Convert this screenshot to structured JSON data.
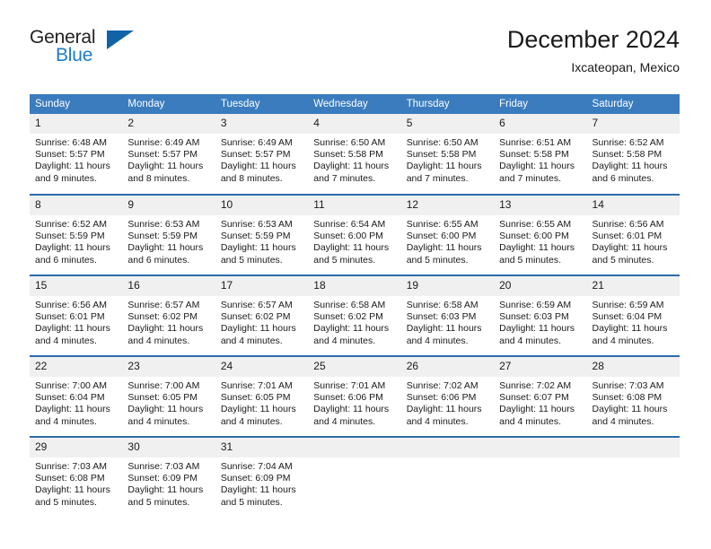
{
  "logo": {
    "word_top": "General",
    "word_bottom": "Blue",
    "triangle_color": "#1163a8",
    "blue_color": "#1d7dc4"
  },
  "header": {
    "title": "December 2024",
    "subtitle": "Ixcateopan, Mexico"
  },
  "colors": {
    "header_row_bg": "#3a7cbe",
    "header_row_text": "#ffffff",
    "row_separator": "#2b6ca8",
    "daynum_bg": "#f0f0f0",
    "page_bg": "#ffffff",
    "text": "#1a1a1a"
  },
  "calendar": {
    "weekday_headers": [
      "Sunday",
      "Monday",
      "Tuesday",
      "Wednesday",
      "Thursday",
      "Friday",
      "Saturday"
    ],
    "weeks": [
      [
        {
          "day": "1",
          "sunrise": "Sunrise: 6:48 AM",
          "sunset": "Sunset: 5:57 PM",
          "daylight_line1": "Daylight: 11 hours",
          "daylight_line2": "and 9 minutes."
        },
        {
          "day": "2",
          "sunrise": "Sunrise: 6:49 AM",
          "sunset": "Sunset: 5:57 PM",
          "daylight_line1": "Daylight: 11 hours",
          "daylight_line2": "and 8 minutes."
        },
        {
          "day": "3",
          "sunrise": "Sunrise: 6:49 AM",
          "sunset": "Sunset: 5:57 PM",
          "daylight_line1": "Daylight: 11 hours",
          "daylight_line2": "and 8 minutes."
        },
        {
          "day": "4",
          "sunrise": "Sunrise: 6:50 AM",
          "sunset": "Sunset: 5:58 PM",
          "daylight_line1": "Daylight: 11 hours",
          "daylight_line2": "and 7 minutes."
        },
        {
          "day": "5",
          "sunrise": "Sunrise: 6:50 AM",
          "sunset": "Sunset: 5:58 PM",
          "daylight_line1": "Daylight: 11 hours",
          "daylight_line2": "and 7 minutes."
        },
        {
          "day": "6",
          "sunrise": "Sunrise: 6:51 AM",
          "sunset": "Sunset: 5:58 PM",
          "daylight_line1": "Daylight: 11 hours",
          "daylight_line2": "and 7 minutes."
        },
        {
          "day": "7",
          "sunrise": "Sunrise: 6:52 AM",
          "sunset": "Sunset: 5:58 PM",
          "daylight_line1": "Daylight: 11 hours",
          "daylight_line2": "and 6 minutes."
        }
      ],
      [
        {
          "day": "8",
          "sunrise": "Sunrise: 6:52 AM",
          "sunset": "Sunset: 5:59 PM",
          "daylight_line1": "Daylight: 11 hours",
          "daylight_line2": "and 6 minutes."
        },
        {
          "day": "9",
          "sunrise": "Sunrise: 6:53 AM",
          "sunset": "Sunset: 5:59 PM",
          "daylight_line1": "Daylight: 11 hours",
          "daylight_line2": "and 6 minutes."
        },
        {
          "day": "10",
          "sunrise": "Sunrise: 6:53 AM",
          "sunset": "Sunset: 5:59 PM",
          "daylight_line1": "Daylight: 11 hours",
          "daylight_line2": "and 5 minutes."
        },
        {
          "day": "11",
          "sunrise": "Sunrise: 6:54 AM",
          "sunset": "Sunset: 6:00 PM",
          "daylight_line1": "Daylight: 11 hours",
          "daylight_line2": "and 5 minutes."
        },
        {
          "day": "12",
          "sunrise": "Sunrise: 6:55 AM",
          "sunset": "Sunset: 6:00 PM",
          "daylight_line1": "Daylight: 11 hours",
          "daylight_line2": "and 5 minutes."
        },
        {
          "day": "13",
          "sunrise": "Sunrise: 6:55 AM",
          "sunset": "Sunset: 6:00 PM",
          "daylight_line1": "Daylight: 11 hours",
          "daylight_line2": "and 5 minutes."
        },
        {
          "day": "14",
          "sunrise": "Sunrise: 6:56 AM",
          "sunset": "Sunset: 6:01 PM",
          "daylight_line1": "Daylight: 11 hours",
          "daylight_line2": "and 5 minutes."
        }
      ],
      [
        {
          "day": "15",
          "sunrise": "Sunrise: 6:56 AM",
          "sunset": "Sunset: 6:01 PM",
          "daylight_line1": "Daylight: 11 hours",
          "daylight_line2": "and 4 minutes."
        },
        {
          "day": "16",
          "sunrise": "Sunrise: 6:57 AM",
          "sunset": "Sunset: 6:02 PM",
          "daylight_line1": "Daylight: 11 hours",
          "daylight_line2": "and 4 minutes."
        },
        {
          "day": "17",
          "sunrise": "Sunrise: 6:57 AM",
          "sunset": "Sunset: 6:02 PM",
          "daylight_line1": "Daylight: 11 hours",
          "daylight_line2": "and 4 minutes."
        },
        {
          "day": "18",
          "sunrise": "Sunrise: 6:58 AM",
          "sunset": "Sunset: 6:02 PM",
          "daylight_line1": "Daylight: 11 hours",
          "daylight_line2": "and 4 minutes."
        },
        {
          "day": "19",
          "sunrise": "Sunrise: 6:58 AM",
          "sunset": "Sunset: 6:03 PM",
          "daylight_line1": "Daylight: 11 hours",
          "daylight_line2": "and 4 minutes."
        },
        {
          "day": "20",
          "sunrise": "Sunrise: 6:59 AM",
          "sunset": "Sunset: 6:03 PM",
          "daylight_line1": "Daylight: 11 hours",
          "daylight_line2": "and 4 minutes."
        },
        {
          "day": "21",
          "sunrise": "Sunrise: 6:59 AM",
          "sunset": "Sunset: 6:04 PM",
          "daylight_line1": "Daylight: 11 hours",
          "daylight_line2": "and 4 minutes."
        }
      ],
      [
        {
          "day": "22",
          "sunrise": "Sunrise: 7:00 AM",
          "sunset": "Sunset: 6:04 PM",
          "daylight_line1": "Daylight: 11 hours",
          "daylight_line2": "and 4 minutes."
        },
        {
          "day": "23",
          "sunrise": "Sunrise: 7:00 AM",
          "sunset": "Sunset: 6:05 PM",
          "daylight_line1": "Daylight: 11 hours",
          "daylight_line2": "and 4 minutes."
        },
        {
          "day": "24",
          "sunrise": "Sunrise: 7:01 AM",
          "sunset": "Sunset: 6:05 PM",
          "daylight_line1": "Daylight: 11 hours",
          "daylight_line2": "and 4 minutes."
        },
        {
          "day": "25",
          "sunrise": "Sunrise: 7:01 AM",
          "sunset": "Sunset: 6:06 PM",
          "daylight_line1": "Daylight: 11 hours",
          "daylight_line2": "and 4 minutes."
        },
        {
          "day": "26",
          "sunrise": "Sunrise: 7:02 AM",
          "sunset": "Sunset: 6:06 PM",
          "daylight_line1": "Daylight: 11 hours",
          "daylight_line2": "and 4 minutes."
        },
        {
          "day": "27",
          "sunrise": "Sunrise: 7:02 AM",
          "sunset": "Sunset: 6:07 PM",
          "daylight_line1": "Daylight: 11 hours",
          "daylight_line2": "and 4 minutes."
        },
        {
          "day": "28",
          "sunrise": "Sunrise: 7:03 AM",
          "sunset": "Sunset: 6:08 PM",
          "daylight_line1": "Daylight: 11 hours",
          "daylight_line2": "and 4 minutes."
        }
      ],
      [
        {
          "day": "29",
          "sunrise": "Sunrise: 7:03 AM",
          "sunset": "Sunset: 6:08 PM",
          "daylight_line1": "Daylight: 11 hours",
          "daylight_line2": "and 5 minutes."
        },
        {
          "day": "30",
          "sunrise": "Sunrise: 7:03 AM",
          "sunset": "Sunset: 6:09 PM",
          "daylight_line1": "Daylight: 11 hours",
          "daylight_line2": "and 5 minutes."
        },
        {
          "day": "31",
          "sunrise": "Sunrise: 7:04 AM",
          "sunset": "Sunset: 6:09 PM",
          "daylight_line1": "Daylight: 11 hours",
          "daylight_line2": "and 5 minutes."
        },
        {
          "day": "",
          "sunrise": "",
          "sunset": "",
          "daylight_line1": "",
          "daylight_line2": ""
        },
        {
          "day": "",
          "sunrise": "",
          "sunset": "",
          "daylight_line1": "",
          "daylight_line2": ""
        },
        {
          "day": "",
          "sunrise": "",
          "sunset": "",
          "daylight_line1": "",
          "daylight_line2": ""
        },
        {
          "day": "",
          "sunrise": "",
          "sunset": "",
          "daylight_line1": "",
          "daylight_line2": ""
        }
      ]
    ]
  }
}
